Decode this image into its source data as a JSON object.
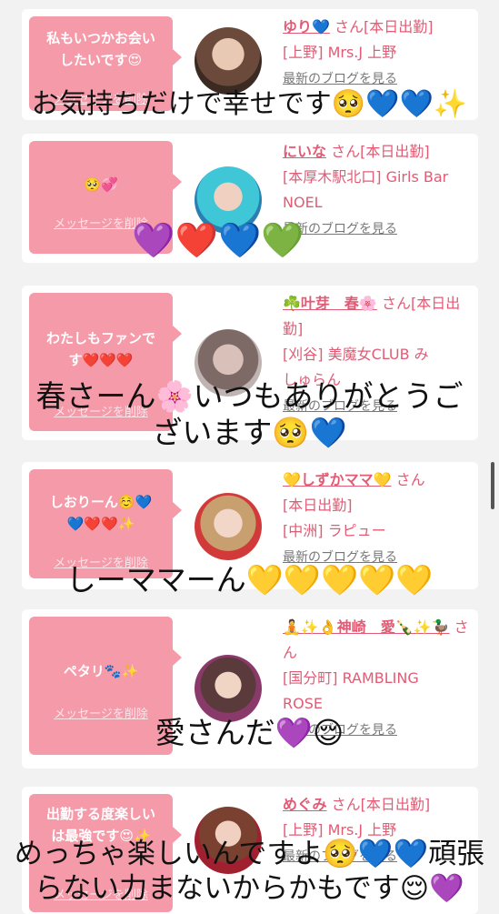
{
  "messages": [
    {
      "bubble": "私もいつかお会い\nしたいです😍",
      "delete": "メッセージを削除",
      "name": "ゆり💙",
      "suffix": "さん[本日出勤]",
      "line2": "[上野] Mrs.J 上野",
      "line3": "",
      "blog": "最新のブログを見る"
    },
    {
      "bubble": "🥺💞",
      "delete": "メッセージを削除",
      "name": "にいな",
      "suffix": "さん[本日出勤]",
      "line2": "[本厚木駅北口] Girls Bar NOEL",
      "line3": "",
      "blog": "最新のブログを見る"
    },
    {
      "bubble": "わたしもファンで\nす❤️❤️❤️",
      "delete": "メッセージを削除",
      "name": "☘️叶芽　春🌸",
      "suffix": "さん[本日出勤]",
      "line2": "[刈谷] 美魔女CLUB み",
      "line3": "しゅらん",
      "blog": "最新のブログを見る"
    },
    {
      "bubble": "しおりーん☺️💙\n💙❤️❤️✨",
      "delete": "メッセージを削除",
      "name": "💛しずかママ💛",
      "suffix": "さん",
      "line2": "[本日出勤]",
      "line3": "[中洲] ラピュー",
      "blog": "最新のブログを見る"
    },
    {
      "bubble": "ペタリ🐾✨",
      "delete": "メッセージを削除",
      "name": "🧘✨👌神崎　愛🍾✨🦆",
      "suffix": "さん",
      "line2": "[国分町] RAMBLING",
      "line3": "ROSE",
      "blog": "最新のブログを見る"
    },
    {
      "bubble": "出勤する度楽しい\nは最強です😍✨",
      "delete": "メッセージを削除",
      "name": "めぐみ",
      "suffix": "さん[本日出勤]",
      "line2": "[上野] Mrs.J 上野",
      "line3": "",
      "blog": "最新のブログを見る"
    }
  ],
  "overlays": {
    "o1": "お気持ちだけで幸せです🥺💙💙✨",
    "o2": "💜❤️💙💚",
    "o3": "春さーん🌸いつもありがとうご\nざいます🥺💙",
    "o4": "しーママーん💛💛💛💛💛",
    "o5": "愛さんだ💜😌",
    "o6": "めっちゃ楽しいんですよ🥺💙💙頑張\nらない力まないからかもです😌💜"
  }
}
